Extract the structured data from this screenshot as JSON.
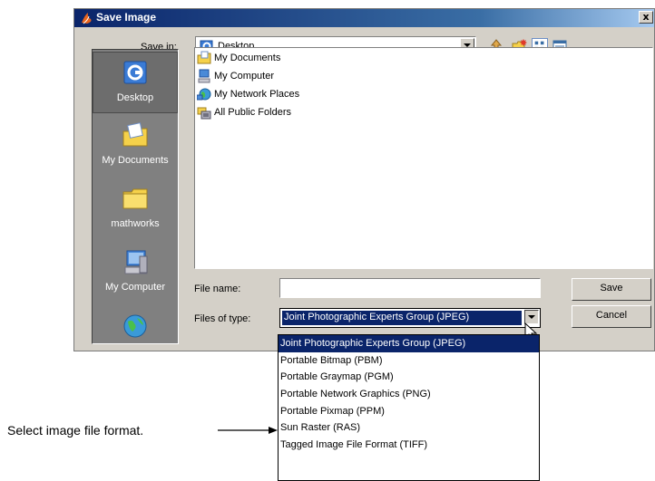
{
  "window": {
    "title": "Save Image",
    "close_label": "x"
  },
  "toolbar": {
    "save_in_label": "Save in:",
    "save_in_value": "Desktop"
  },
  "places": [
    {
      "label": "Desktop",
      "icon": "desktop-icon"
    },
    {
      "label": "My Documents",
      "icon": "my-documents-icon"
    },
    {
      "label": "mathworks",
      "icon": "folder-icon"
    },
    {
      "label": "My Computer",
      "icon": "my-computer-icon"
    },
    {
      "label": "",
      "icon": "network-icon"
    }
  ],
  "files": [
    {
      "label": "My Documents",
      "icon": "my-documents-icon"
    },
    {
      "label": "My Computer",
      "icon": "my-computer-icon"
    },
    {
      "label": "My Network Places",
      "icon": "network-places-icon"
    },
    {
      "label": "All Public Folders",
      "icon": "public-folders-icon"
    }
  ],
  "form": {
    "file_name_label": "File name:",
    "file_name_value": "",
    "files_of_type_label": "Files of type:",
    "files_of_type_value": "Joint Photographic Experts Group (JPEG)",
    "save_button": "Save",
    "cancel_button": "Cancel"
  },
  "type_options": [
    "Joint Photographic Experts Group (JPEG)",
    "Portable Bitmap (PBM)",
    "Portable Graymap (PGM)",
    "Portable Network Graphics (PNG)",
    "Portable Pixmap (PPM)",
    "Sun Raster (RAS)",
    "Tagged Image File Format (TIFF)"
  ],
  "callout": {
    "text": "Select image file format."
  },
  "colors": {
    "title_start": "#0a246a",
    "selection": "#0a246a",
    "dialog_bg": "#d4d0c8"
  }
}
